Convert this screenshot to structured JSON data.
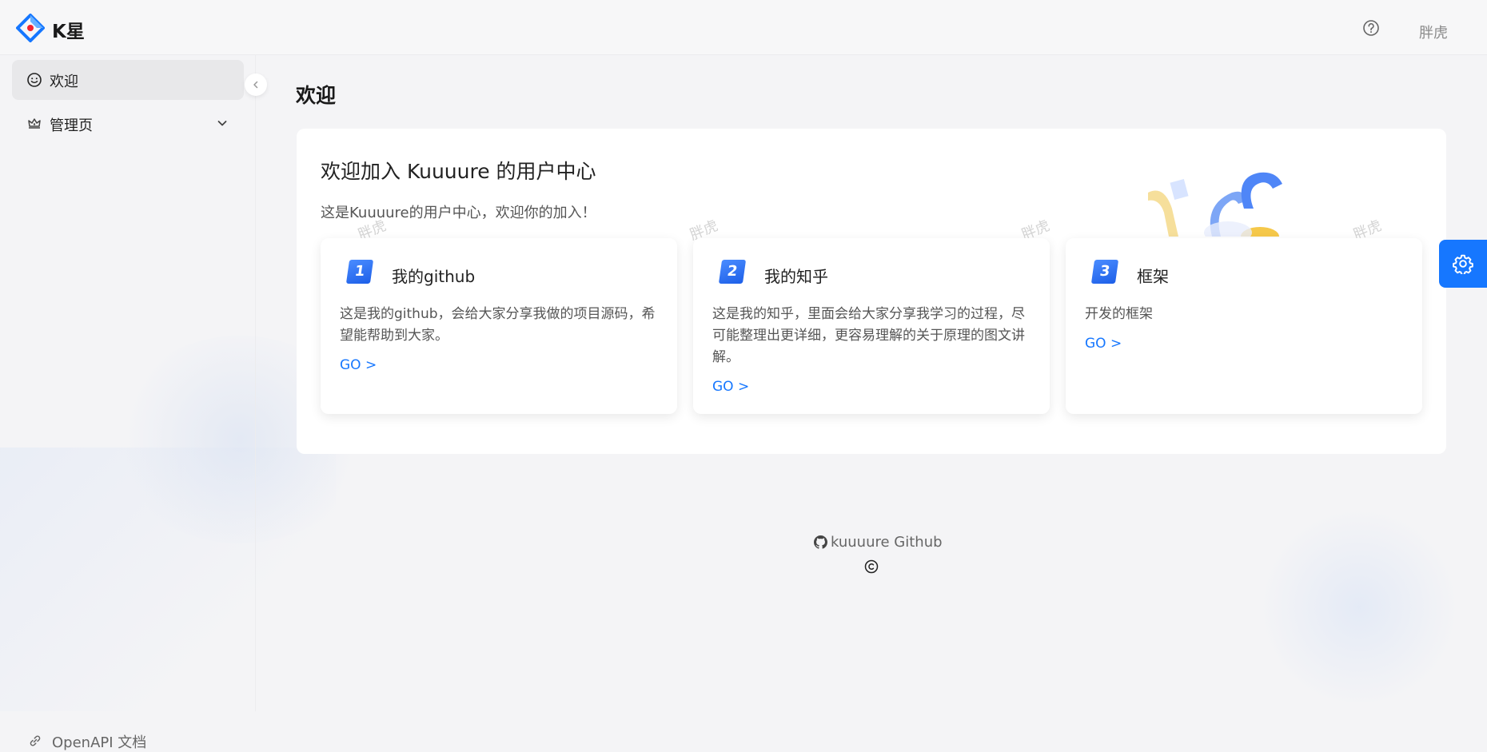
{
  "header": {
    "app_title": "K星",
    "user_name": "胖虎",
    "logo_icon": "diamond-logo-icon",
    "help_icon": "question-circle-icon"
  },
  "sidebar": {
    "items": [
      {
        "label": "欢迎",
        "icon": "smile-icon",
        "active": true
      },
      {
        "label": "管理页",
        "icon": "crown-icon",
        "expandable": true
      }
    ],
    "bottom_link": {
      "label": "OpenAPI 文档",
      "icon": "link-icon"
    }
  },
  "main": {
    "page_title": "欢迎",
    "welcome_card": {
      "title": "欢迎加入 Kuuuure 的用户中心",
      "subtitle": "这是Kuuuure的用户中心，欢迎你的加入！",
      "watermark": "胖虎"
    },
    "features": [
      {
        "number": "1",
        "title": "我的github",
        "description": "这是我的github，会给大家分享我做的项目源码，希望能帮助到大家。",
        "link": "GO >"
      },
      {
        "number": "2",
        "title": "我的知乎",
        "description": "这是我的知乎，里面会给大家分享我学习的过程，尽可能整理出更详细，更容易理解的关于原理的图文讲解。",
        "link": "GO >"
      },
      {
        "number": "3",
        "title": "框架",
        "description": "开发的框架",
        "link": "GO >"
      }
    ]
  },
  "footer": {
    "link_label": "kuuuure Github",
    "github_icon": "github-icon",
    "copyright_icon": "copyright-icon"
  },
  "settings": {
    "icon": "gear-icon"
  },
  "colors": {
    "accent": "#1677ff",
    "badge": "#2f6ff0"
  }
}
